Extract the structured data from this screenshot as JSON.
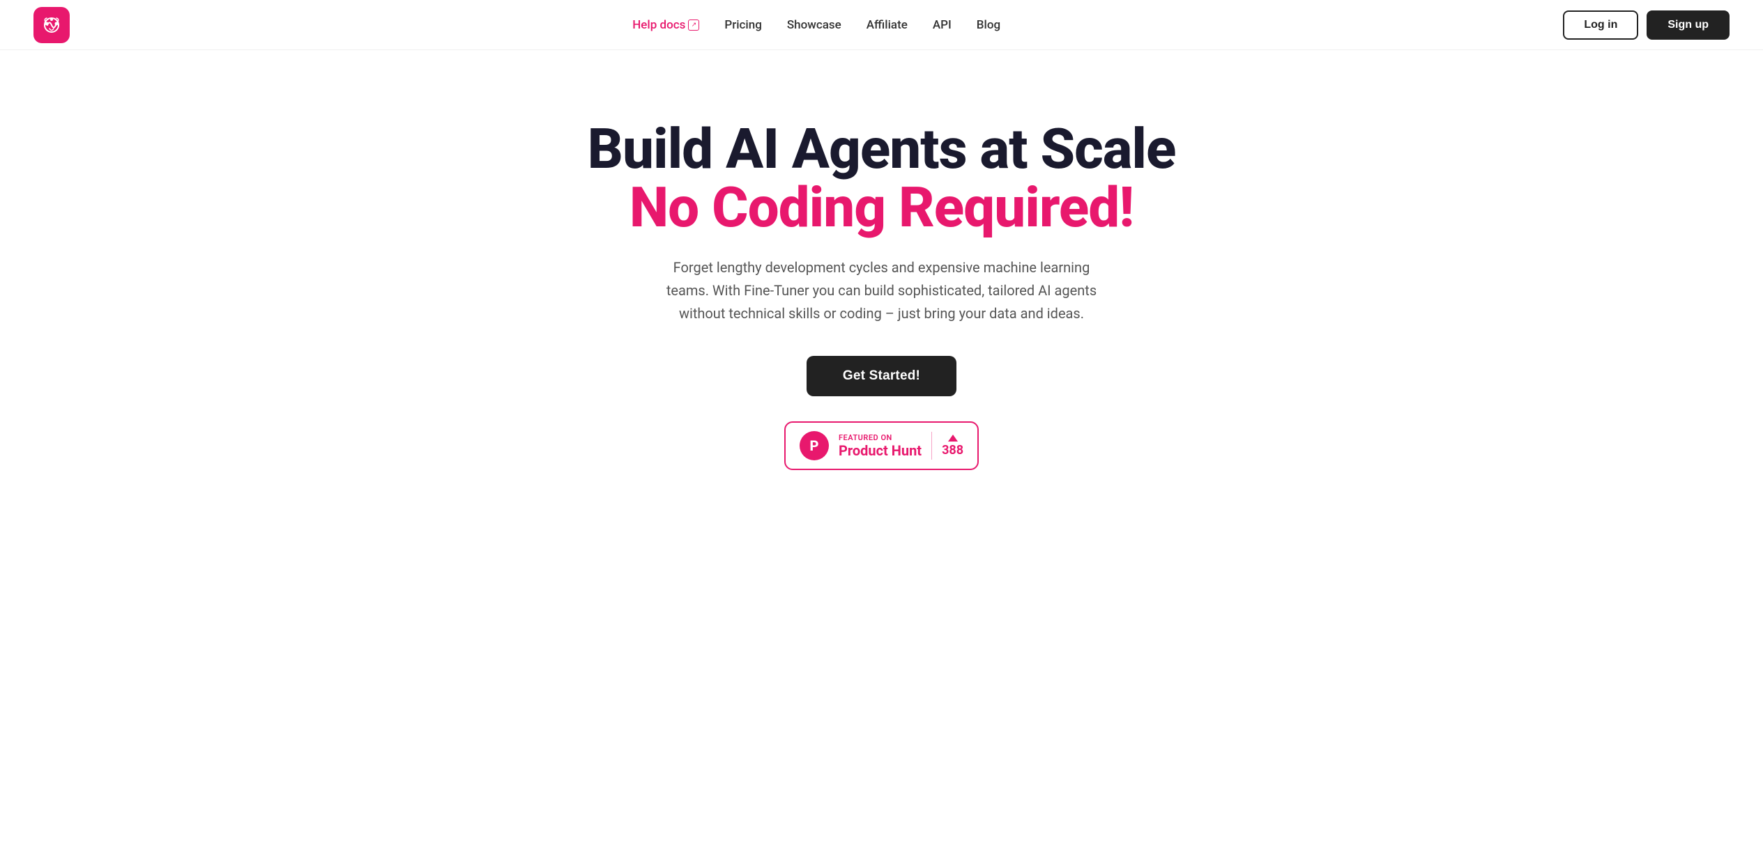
{
  "brand": {
    "logo_alt": "Fine-Tuner logo"
  },
  "nav": {
    "links": [
      {
        "id": "help-docs",
        "label": "Help docs",
        "has_ext": true,
        "pink": true
      },
      {
        "id": "pricing",
        "label": "Pricing",
        "has_ext": false,
        "pink": false
      },
      {
        "id": "showcase",
        "label": "Showcase",
        "has_ext": false,
        "pink": false
      },
      {
        "id": "affiliate",
        "label": "Affiliate",
        "has_ext": false,
        "pink": false
      },
      {
        "id": "api",
        "label": "API",
        "has_ext": false,
        "pink": false
      },
      {
        "id": "blog",
        "label": "Blog",
        "has_ext": false,
        "pink": false
      }
    ]
  },
  "header": {
    "login_label": "Log in",
    "signup_label": "Sign up"
  },
  "hero": {
    "title_line1": "Build AI Agents at Scale",
    "title_line2": "No Coding Required!",
    "subtitle": "Forget lengthy development cycles and expensive machine learning teams. With Fine-Tuner you can build sophisticated, tailored AI agents without technical skills or coding – just bring your data and ideas.",
    "cta_label": "Get Started!"
  },
  "product_hunt": {
    "featured_label": "FEATURED ON",
    "product_name": "Product Hunt",
    "vote_count": "388",
    "logo_letter": "P"
  },
  "colors": {
    "pink": "#e8186d",
    "dark": "#1a1a2e",
    "gray_text": "#555555"
  }
}
